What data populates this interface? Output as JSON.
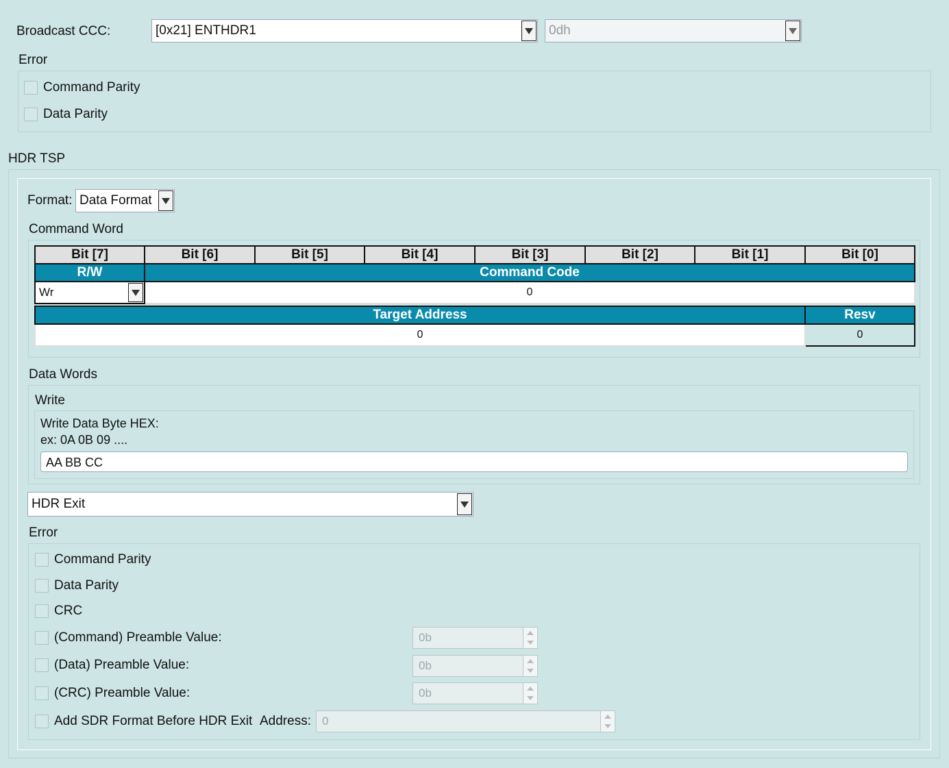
{
  "broadcast": {
    "label": "Broadcast CCC:",
    "selected": "[0x21] ENTHDR1",
    "secondary_value": "0dh"
  },
  "error_top": {
    "title": "Error",
    "options": [
      "Command Parity",
      "Data Parity"
    ]
  },
  "hdr_tsp": {
    "title": "HDR TSP",
    "format_label": "Format:",
    "format_value": "Data Format",
    "command_word": {
      "title": "Command Word",
      "bit_headers": [
        "Bit [7]",
        "Bit [6]",
        "Bit [5]",
        "Bit [4]",
        "Bit [3]",
        "Bit [2]",
        "Bit [1]",
        "Bit [0]"
      ],
      "rw_label": "R/W",
      "command_code_label": "Command Code",
      "rw_value": "Wr",
      "command_code_value": "0",
      "target_address_label": "Target Address",
      "resv_label": "Resv",
      "target_address_value": "0",
      "resv_value": "0",
      "colors": {
        "header_blue": "#0a8bab",
        "bit_header_bg": "#e0e0e0"
      }
    },
    "data_words": {
      "title": "Data Words",
      "write_title": "Write",
      "hint_line1": "Write Data Byte HEX:",
      "hint_line2": "ex: 0A 0B 09 ....",
      "input_value": "AA BB CC"
    },
    "exit_select": "HDR Exit",
    "error_bottom": {
      "title": "Error",
      "options": [
        "Command Parity",
        "Data Parity",
        "CRC",
        "(Command) Preamble Value:",
        "(Data) Preamble Value:",
        "(CRC) Preamble Value:",
        "Add SDR Format Before HDR Exit"
      ],
      "preamble_values": [
        "0b",
        "0b",
        "0b"
      ],
      "address_label": "Address:",
      "address_value": "0"
    }
  }
}
